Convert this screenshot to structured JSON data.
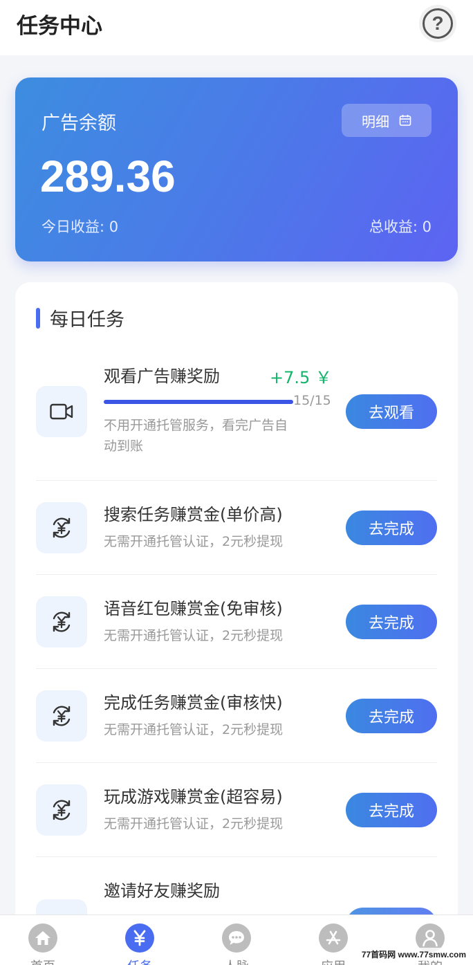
{
  "header": {
    "title": "任务中心",
    "help_icon": "question-circle-icon"
  },
  "balance_card": {
    "label": "广告余额",
    "detail_label": "明细",
    "amount": "289.36",
    "today_income": "今日收益: 0",
    "total_income": "总收益: 0"
  },
  "daily_tasks": {
    "title": "每日任务",
    "items": [
      {
        "title": "观看广告赚奖励",
        "reward": "+7.5 ￥",
        "progress_text": "15/15",
        "progress": 1.0,
        "desc": "不用开通托管服务，看完广告自",
        "desc2": "动到账",
        "button": "去观看",
        "icon": "video-camera-icon"
      },
      {
        "title": "搜索任务赚赏金(单价高)",
        "desc": "无需开通托管认证，2元秒提现",
        "button": "去完成",
        "icon": "yuan-exchange-icon"
      },
      {
        "title": "语音红包赚赏金(免审核)",
        "desc": "无需开通托管认证，2元秒提现",
        "button": "去完成",
        "icon": "yuan-exchange-icon"
      },
      {
        "title": "完成任务赚赏金(审核快)",
        "desc": "无需开通托管认证，2元秒提现",
        "button": "去完成",
        "icon": "yuan-exchange-icon"
      },
      {
        "title": "玩成游戏赚赏金(超容易)",
        "desc": "无需开通托管认证，2元秒提现",
        "button": "去完成",
        "icon": "yuan-exchange-icon"
      },
      {
        "title": "邀请好友赚奖励",
        "desc": "",
        "button": "",
        "icon": "invite-icon"
      }
    ]
  },
  "bottom_nav": {
    "items": [
      {
        "label": "首页",
        "icon": "home-icon"
      },
      {
        "label": "任务",
        "icon": "yuan-icon",
        "active": true
      },
      {
        "label": "人脉",
        "icon": "chat-icon"
      },
      {
        "label": "应用",
        "icon": "app-store-icon"
      },
      {
        "label": "我的",
        "icon": "user-icon"
      }
    ]
  },
  "watermark": "77首码网 www.77smw.com",
  "colors": {
    "accent": "#4a6cf0",
    "reward": "#16b36b",
    "card_gradient_start": "#3d8de0",
    "card_gradient_end": "#5d63f2"
  }
}
